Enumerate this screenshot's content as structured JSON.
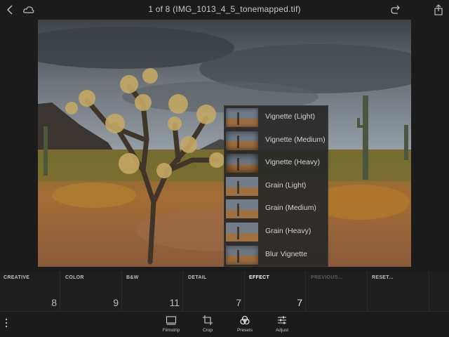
{
  "header": {
    "title": "1 of 8 (IMG_1013_4_5_tonemapped.tif)"
  },
  "presets": [
    {
      "label": "Vignette (Light)"
    },
    {
      "label": "Vignette (Medium)"
    },
    {
      "label": "Vignette (Heavy)"
    },
    {
      "label": "Grain (Light)"
    },
    {
      "label": "Grain (Medium)"
    },
    {
      "label": "Grain (Heavy)"
    },
    {
      "label": "Blur Vignette"
    }
  ],
  "categories": [
    {
      "name": "CREATIVE",
      "count": "8"
    },
    {
      "name": "COLOR",
      "count": "9"
    },
    {
      "name": "B&W",
      "count": "11"
    },
    {
      "name": "DETAIL",
      "count": "7"
    },
    {
      "name": "EFFECT",
      "count": "7"
    },
    {
      "name": "PREVIOUS...",
      "count": ""
    },
    {
      "name": "RESET...",
      "count": ""
    }
  ],
  "toolbar": {
    "filmstrip": "Filmstrip",
    "crop": "Crop",
    "presets": "Presets",
    "adjust": "Adjust"
  },
  "colors": {
    "background": "#1b1b1b",
    "sky": "#4e555d",
    "ground": "#9a6a3d"
  }
}
